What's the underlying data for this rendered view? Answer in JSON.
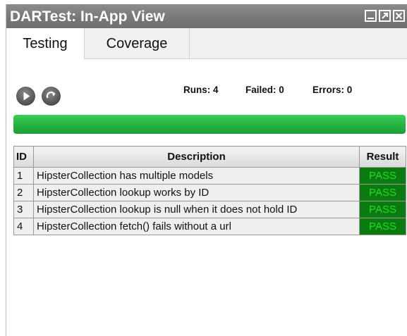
{
  "window": {
    "title": "DARTest: In-App View",
    "controls": [
      "minimize-icon",
      "maximize-icon",
      "close-icon"
    ]
  },
  "tabs": [
    {
      "label": "Testing",
      "active": true
    },
    {
      "label": "Coverage",
      "active": false
    }
  ],
  "controls": {
    "run": "play-icon",
    "rerun": "redo-icon"
  },
  "stats": {
    "runs_label": "Runs:",
    "runs": "4",
    "failed_label": "Failed:",
    "failed": "0",
    "errors_label": "Errors:",
    "errors": "0"
  },
  "progress": {
    "fraction": 1.0,
    "color": "#2ab545"
  },
  "table": {
    "headers": {
      "id": "ID",
      "description": "Description",
      "result": "Result"
    },
    "rows": [
      {
        "id": "1",
        "description": "HipsterCollection has multiple models",
        "result": "PASS"
      },
      {
        "id": "2",
        "description": "HipsterCollection lookup works by ID",
        "result": "PASS"
      },
      {
        "id": "3",
        "description": "HipsterCollection lookup is null when it does not hold ID",
        "result": "PASS"
      },
      {
        "id": "4",
        "description": "HipsterCollection fetch() fails without a url",
        "result": "PASS"
      }
    ]
  },
  "colors": {
    "titlebar": "#7a7a7a",
    "pass_bg": "#0b7a10",
    "pass_text": "#22dd22"
  }
}
